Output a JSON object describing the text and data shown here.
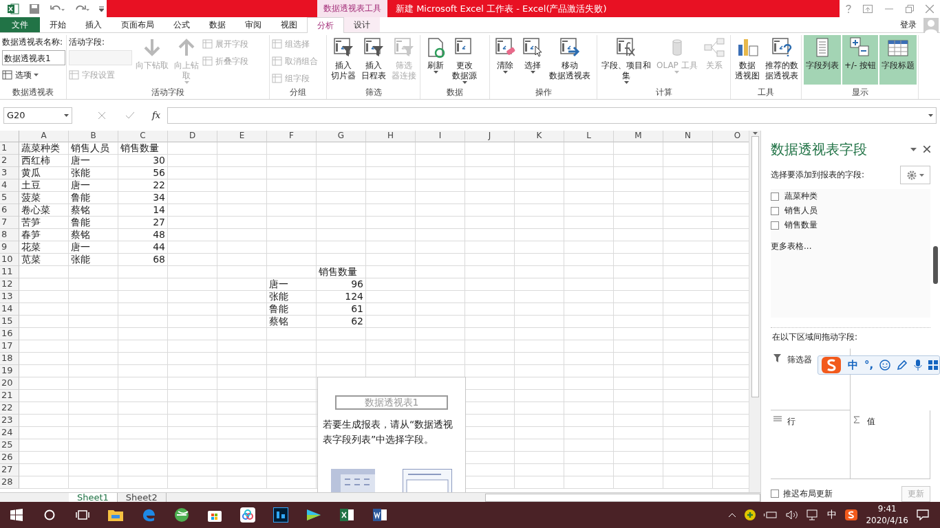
{
  "title_bar": {
    "context_tab": "数据透视表工具",
    "title": "新建 Microsoft Excel 工作表 -  Excel(产品激活失败)"
  },
  "ribbon_tabs": [
    {
      "label": "文件",
      "kind": "file",
      "selected": false
    },
    {
      "label": "开始",
      "kind": "normal",
      "selected": false
    },
    {
      "label": "插入",
      "kind": "normal",
      "selected": false
    },
    {
      "label": "页面布局",
      "kind": "normal",
      "selected": false
    },
    {
      "label": "公式",
      "kind": "normal",
      "selected": false
    },
    {
      "label": "数据",
      "kind": "normal",
      "selected": false
    },
    {
      "label": "审阅",
      "kind": "normal",
      "selected": false
    },
    {
      "label": "视图",
      "kind": "normal",
      "selected": false
    },
    {
      "label": "分析",
      "kind": "context",
      "selected": true
    },
    {
      "label": "设计",
      "kind": "context",
      "selected": false
    }
  ],
  "account": {
    "label": "登录"
  },
  "ribbon_groups": [
    {
      "label": "数据透视表",
      "items": [
        {
          "kind": "stack",
          "items": [
            {
              "kind": "caption",
              "label": "数据透视表名称:"
            },
            {
              "kind": "input",
              "value": "数据透视表1",
              "disabled": false
            },
            {
              "kind": "small",
              "label": "选项",
              "caret": true,
              "disabled": false
            }
          ]
        }
      ]
    },
    {
      "label": "活动字段",
      "items": [
        {
          "kind": "stack",
          "items": [
            {
              "kind": "caption",
              "label": "活动字段:"
            },
            {
              "kind": "input",
              "disabled": true
            },
            {
              "kind": "small",
              "label": "字段设置",
              "caret": false,
              "disabled": true
            }
          ]
        },
        {
          "kind": "large",
          "lines": [
            "向下钻取"
          ],
          "caret": false,
          "disabled": true
        },
        {
          "kind": "large",
          "lines": [
            "向上钻",
            "取"
          ],
          "caret": true,
          "disabled": true
        },
        {
          "kind": "stack",
          "items": [
            {
              "kind": "small",
              "label": "展开字段",
              "caret": false,
              "disabled": true
            },
            {
              "kind": "small",
              "label": "折叠字段",
              "caret": false,
              "disabled": true
            }
          ]
        }
      ]
    },
    {
      "label": "分组",
      "items": [
        {
          "kind": "stack",
          "items": [
            {
              "kind": "small",
              "label": "组选择",
              "caret": false,
              "disabled": true
            },
            {
              "kind": "small",
              "label": "取消组合",
              "caret": false,
              "disabled": true
            },
            {
              "kind": "small",
              "label": "组字段",
              "caret": false,
              "disabled": true
            }
          ]
        }
      ]
    },
    {
      "label": "筛选",
      "items": [
        {
          "kind": "large",
          "lines": [
            "插入",
            "切片器"
          ],
          "caret": false,
          "disabled": false
        },
        {
          "kind": "large",
          "lines": [
            "插入",
            "日程表"
          ],
          "caret": false,
          "disabled": false
        },
        {
          "kind": "large",
          "lines": [
            "筛选",
            "器连接"
          ],
          "caret": false,
          "disabled": true
        }
      ]
    },
    {
      "label": "数据",
      "items": [
        {
          "kind": "large",
          "lines": [
            "刷新"
          ],
          "caret": true,
          "disabled": false
        },
        {
          "kind": "large",
          "lines": [
            "更改",
            "数据源"
          ],
          "caret": true,
          "disabled": false
        }
      ]
    },
    {
      "label": "操作",
      "items": [
        {
          "kind": "large",
          "lines": [
            "清除"
          ],
          "caret": true,
          "disabled": false
        },
        {
          "kind": "large",
          "lines": [
            "选择"
          ],
          "caret": true,
          "disabled": false
        },
        {
          "kind": "large",
          "lines": [
            "移动",
            "数据透视表"
          ],
          "caret": false,
          "disabled": false
        }
      ]
    },
    {
      "label": "计算",
      "items": [
        {
          "kind": "large",
          "lines": [
            "字段、项目和",
            "集"
          ],
          "caret": true,
          "disabled": false
        },
        {
          "kind": "large",
          "lines": [
            "OLAP 工具"
          ],
          "caret": true,
          "disabled": true
        },
        {
          "kind": "large",
          "lines": [
            "关系"
          ],
          "caret": false,
          "disabled": true
        }
      ]
    },
    {
      "label": "工具",
      "items": [
        {
          "kind": "large",
          "lines": [
            "数据",
            "透视图"
          ],
          "caret": false,
          "disabled": false
        },
        {
          "kind": "large",
          "lines": [
            "推荐的数",
            "据透视表"
          ],
          "caret": false,
          "disabled": false
        }
      ]
    },
    {
      "label": "显示",
      "items": [
        {
          "kind": "large",
          "lines": [
            "字段列表"
          ],
          "caret": false,
          "disabled": false,
          "on": true
        },
        {
          "kind": "large",
          "lines": [
            "+/- 按钮"
          ],
          "caret": false,
          "disabled": false,
          "on": true
        },
        {
          "kind": "large",
          "lines": [
            "字段标题"
          ],
          "caret": false,
          "disabled": false,
          "on": true
        }
      ]
    }
  ],
  "formula_bar": {
    "name_box": "G20",
    "function_button": "fx"
  },
  "columns": [
    "A",
    "B",
    "C",
    "D",
    "E",
    "F",
    "G",
    "H",
    "I",
    "J",
    "K",
    "L",
    "M",
    "N",
    "O"
  ],
  "row_numbers": [
    "1",
    "2",
    "3",
    "4",
    "5",
    "6",
    "7",
    "8",
    "9",
    "10",
    "11",
    "12",
    "13",
    "14",
    "15",
    "16",
    "17",
    "18",
    "19",
    "20",
    "21",
    "22",
    "23",
    "24",
    "25",
    "26",
    "27",
    "28"
  ],
  "source_table": {
    "header": [
      "蔬菜种类",
      "销售人员",
      "销售数量"
    ],
    "rows": [
      [
        "西红柿",
        "唐一",
        "30"
      ],
      [
        "黄瓜",
        "张能",
        "56"
      ],
      [
        "土豆",
        "唐一",
        "22"
      ],
      [
        "菠菜",
        "鲁能",
        "34"
      ],
      [
        "卷心菜",
        "蔡铭",
        "14"
      ],
      [
        "苦笋",
        "鲁能",
        "27"
      ],
      [
        "春笋",
        "蔡铭",
        "48"
      ],
      [
        "花菜",
        "唐一",
        "44"
      ],
      [
        "苋菜",
        "张能",
        "68"
      ]
    ]
  },
  "pivot_table": {
    "header": "销售数量",
    "rows": [
      [
        "唐一",
        "96"
      ],
      [
        "张能",
        "124"
      ],
      [
        "鲁能",
        "61"
      ],
      [
        "蔡铭",
        "62"
      ]
    ]
  },
  "pivot_placeholder": {
    "title": "数据透视表1",
    "text": "若要生成报表，请从“数据透视表字段列表”中选择字段。"
  },
  "sheet_tabs": [
    {
      "label": "Sheet1",
      "selected": true
    },
    {
      "label": "Sheet2",
      "selected": false
    }
  ],
  "field_pane": {
    "title": "数据透视表字段",
    "subtitle": "选择要添加到报表的字段:",
    "fields": [
      {
        "label": "蔬菜种类",
        "checked": false
      },
      {
        "label": "销售人员",
        "checked": false
      },
      {
        "label": "销售数量",
        "checked": false
      }
    ],
    "more_tables": "更多表格...",
    "areas_hint": "在以下区域间拖动字段:",
    "areas": [
      {
        "label": "筛选器",
        "kind": "filter"
      },
      {
        "label": "行",
        "kind": "rows"
      },
      {
        "label": "值",
        "kind": "values"
      }
    ],
    "defer": {
      "label": "推迟布局更新",
      "checked": false
    },
    "update_button": {
      "label": "更新",
      "disabled": true
    }
  },
  "ime_toolbar": {
    "mode": "中",
    "punctuation": "°,"
  },
  "taskbar": {
    "input_indicator": "中",
    "time": "9:41",
    "date": "2020/4/16"
  }
}
